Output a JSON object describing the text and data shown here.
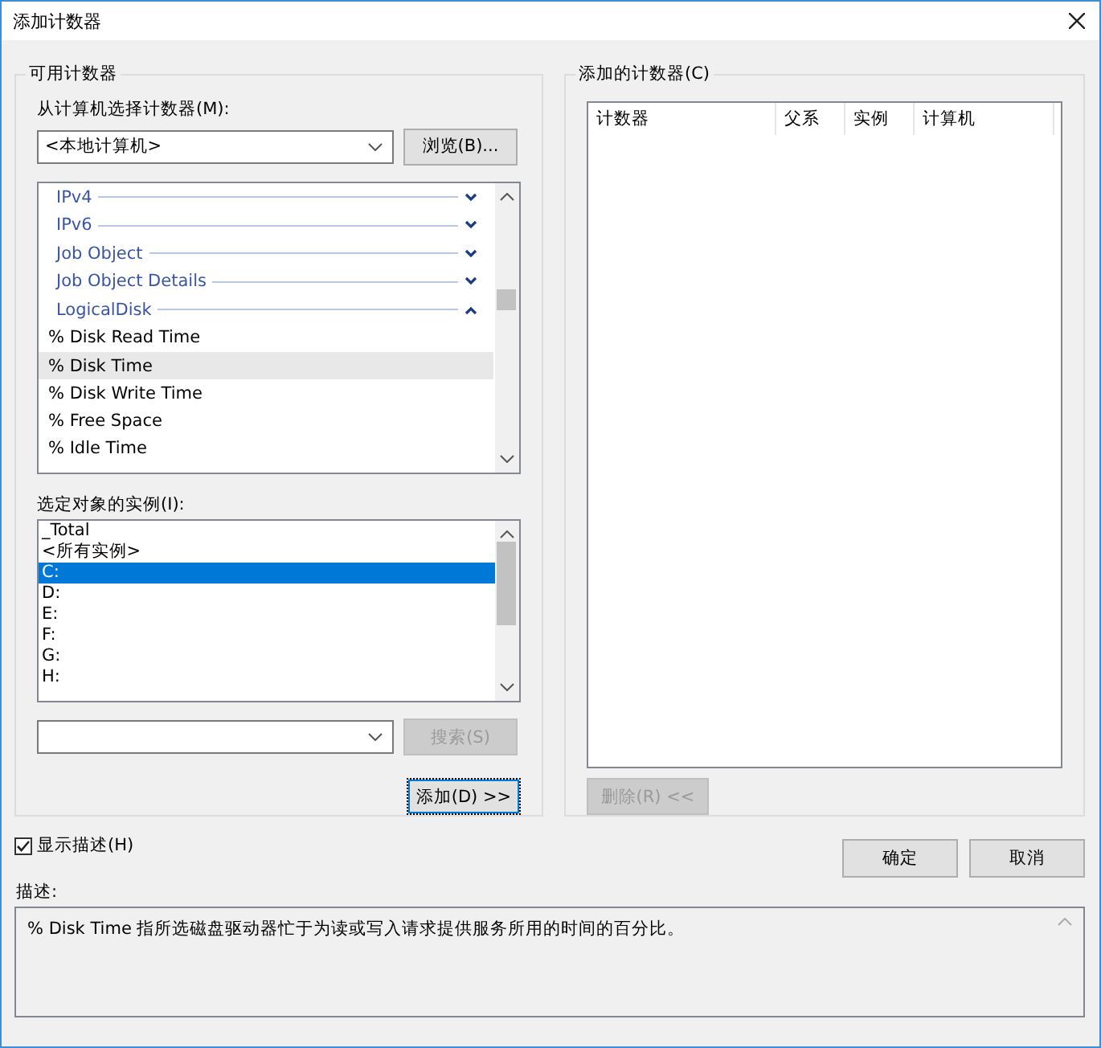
{
  "window": {
    "title": "添加计数器"
  },
  "available": {
    "title": "可用计数器",
    "computer_label": "从计算机选择计数器(M):",
    "computer_value": "<本地计算机>",
    "browse_button": "浏览(B)...",
    "counters": [
      {
        "kind": "category",
        "label": "IPv4",
        "expanded": false
      },
      {
        "kind": "category",
        "label": "IPv6",
        "expanded": false
      },
      {
        "kind": "category",
        "label": "Job Object",
        "expanded": false
      },
      {
        "kind": "category",
        "label": "Job Object Details",
        "expanded": false
      },
      {
        "kind": "category",
        "label": "LogicalDisk",
        "expanded": true
      },
      {
        "kind": "counter",
        "label": "% Disk Read Time",
        "selected": false
      },
      {
        "kind": "counter",
        "label": "% Disk Time",
        "selected": true
      },
      {
        "kind": "counter",
        "label": "% Disk Write Time",
        "selected": false
      },
      {
        "kind": "counter",
        "label": "% Free Space",
        "selected": false
      },
      {
        "kind": "counter",
        "label": "% Idle Time",
        "selected": false
      }
    ],
    "instances_label": "选定对象的实例(I):",
    "instances": [
      {
        "label": "_Total",
        "selected": false
      },
      {
        "label": "<所有实例>",
        "selected": false
      },
      {
        "label": "C:",
        "selected": true
      },
      {
        "label": "D:",
        "selected": false
      },
      {
        "label": "E:",
        "selected": false
      },
      {
        "label": "F:",
        "selected": false
      },
      {
        "label": "G:",
        "selected": false
      },
      {
        "label": "H:",
        "selected": false
      }
    ],
    "search_button": {
      "label": "搜索(S)",
      "disabled": true
    },
    "add_button": {
      "label": "添加(D) >>",
      "disabled": false
    }
  },
  "added": {
    "title": "添加的计数器(C)",
    "columns": [
      "计数器",
      "父系",
      "实例",
      "计算机"
    ],
    "remove_button": {
      "label": "删除(R) <<",
      "disabled": true
    }
  },
  "show_description": {
    "label": "显示描述(H)",
    "checked": true
  },
  "ok_button": "确定",
  "cancel_button": "取消",
  "description_label": "描述:",
  "description": "% Disk Time 指所选磁盘驱动器忙于为读或写入请求提供服务所用的时间的百分比。"
}
